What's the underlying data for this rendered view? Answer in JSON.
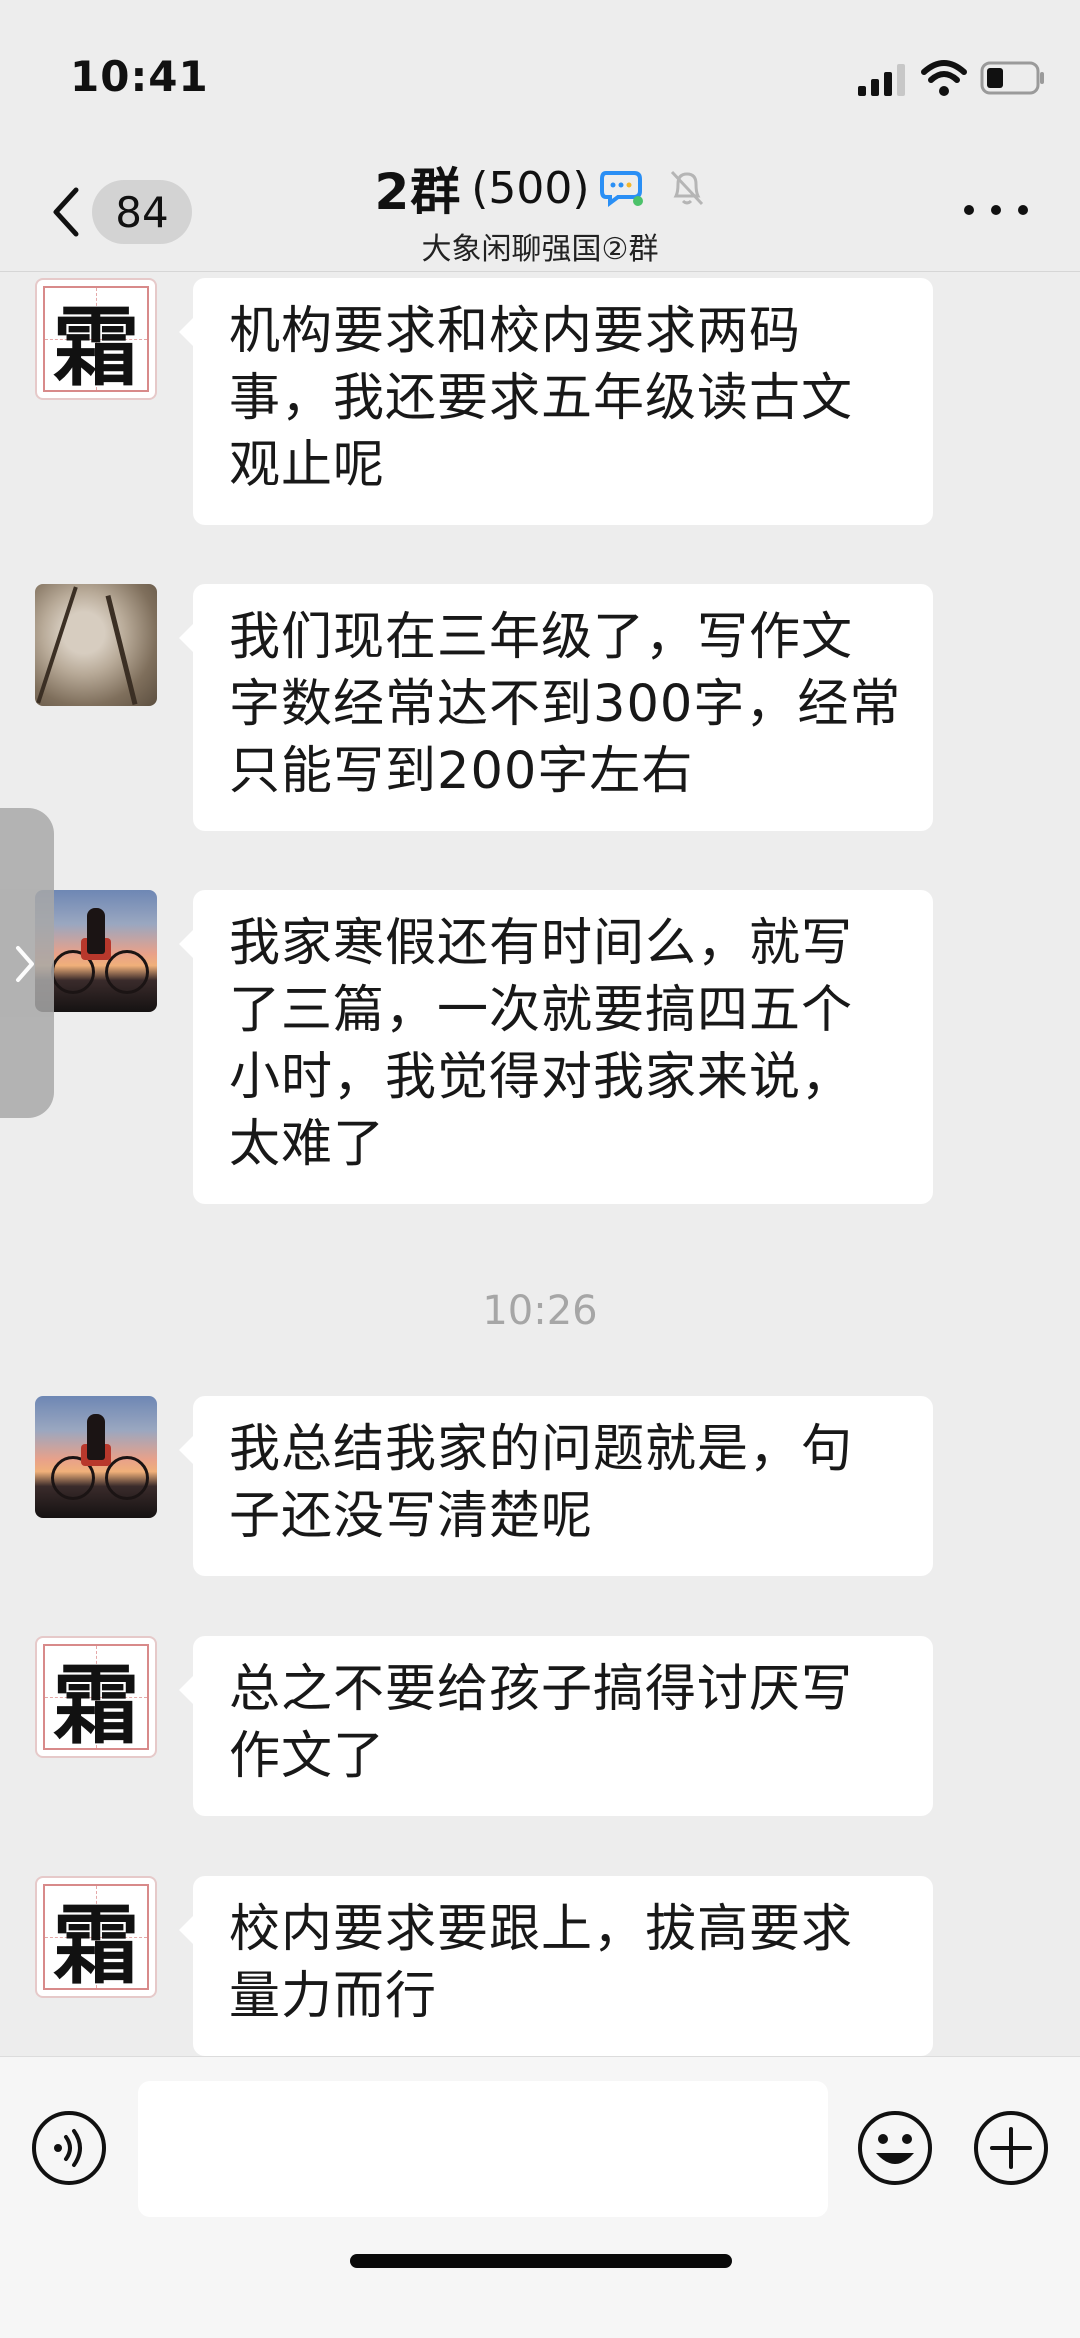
{
  "status_bar": {
    "time": "10:41",
    "icons": [
      "cellular-signal-icon",
      "wifi-icon",
      "battery-icon"
    ]
  },
  "nav": {
    "back_icon": "chevron-left-icon",
    "unread_count": "84",
    "title": "2群",
    "member_count": "(500)",
    "title_icons": [
      "chat-bubble-icon",
      "bell-muted-icon"
    ],
    "subtitle": "大象闲聊强国②群",
    "more_icon": "more-dots-icon"
  },
  "messages": [
    {
      "avatar": "frost-char-avatar",
      "avatar_char": "霜",
      "text": "机构要求和校内要求两码事，我还要求五年级读古文观止呢"
    },
    {
      "avatar": "tree-photo-avatar",
      "text": "我们现在三年级了，写作文字数经常达不到300字，经常只能写到200字左右"
    },
    {
      "avatar": "sunset-bike-avatar",
      "text": "我家寒假还有时间么，就写了三篇，一次就要搞四五个小时，我觉得对我家来说，太难了"
    },
    {
      "timestamp": "10:26"
    },
    {
      "avatar": "sunset-bike-avatar",
      "text": "我总结我家的问题就是，句子还没写清楚呢"
    },
    {
      "avatar": "frost-char-avatar",
      "avatar_char": "霜",
      "text": "总之不要给孩子搞得讨厌写作文了"
    },
    {
      "avatar": "frost-char-avatar",
      "avatar_char": "霜",
      "text": "校内要求要跟上，拔高要求量力而行"
    }
  ],
  "input_bar": {
    "voice_icon": "voice-icon",
    "input_value": "",
    "emoji_icon": "emoji-icon",
    "plus_icon": "plus-icon"
  },
  "colors": {
    "background": "#ededed",
    "bubble": "#ffffff",
    "badge": "#d3d3d3",
    "timestamp": "#a6a6a6"
  }
}
